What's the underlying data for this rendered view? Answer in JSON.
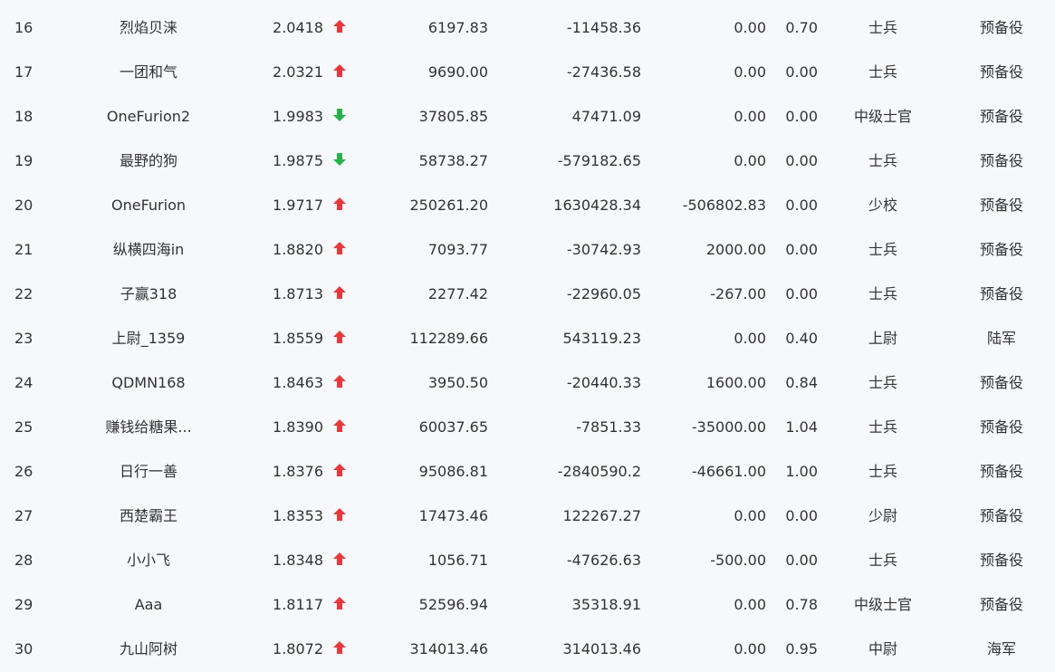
{
  "colors": {
    "up": "#e8383d",
    "down": "#27b14a",
    "text": "#333333",
    "background": "#f6f8fb"
  },
  "rows": [
    {
      "rank": "16",
      "name": "烈焰贝涞",
      "ratio": "2.0418",
      "trend": "up",
      "v1": "6197.83",
      "v2": "-11458.36",
      "v3": "0.00",
      "v4": "0.70",
      "rank_title": "士兵",
      "branch": "预备役"
    },
    {
      "rank": "17",
      "name": "一团和气",
      "ratio": "2.0321",
      "trend": "up",
      "v1": "9690.00",
      "v2": "-27436.58",
      "v3": "0.00",
      "v4": "0.00",
      "rank_title": "士兵",
      "branch": "预备役"
    },
    {
      "rank": "18",
      "name": "OneFurion2",
      "ratio": "1.9983",
      "trend": "down",
      "v1": "37805.85",
      "v2": "47471.09",
      "v3": "0.00",
      "v4": "0.00",
      "rank_title": "中级士官",
      "branch": "预备役"
    },
    {
      "rank": "19",
      "name": "最野的狗",
      "ratio": "1.9875",
      "trend": "down",
      "v1": "58738.27",
      "v2": "-579182.65",
      "v3": "0.00",
      "v4": "0.00",
      "rank_title": "士兵",
      "branch": "预备役"
    },
    {
      "rank": "20",
      "name": "OneFurion",
      "ratio": "1.9717",
      "trend": "up",
      "v1": "250261.20",
      "v2": "1630428.34",
      "v3": "-506802.83",
      "v4": "0.00",
      "rank_title": "少校",
      "branch": "预备役"
    },
    {
      "rank": "21",
      "name": "纵横四海in",
      "ratio": "1.8820",
      "trend": "up",
      "v1": "7093.77",
      "v2": "-30742.93",
      "v3": "2000.00",
      "v4": "0.00",
      "rank_title": "士兵",
      "branch": "预备役"
    },
    {
      "rank": "22",
      "name": "子赢318",
      "ratio": "1.8713",
      "trend": "up",
      "v1": "2277.42",
      "v2": "-22960.05",
      "v3": "-267.00",
      "v4": "0.00",
      "rank_title": "士兵",
      "branch": "预备役"
    },
    {
      "rank": "23",
      "name": "上尉_1359",
      "ratio": "1.8559",
      "trend": "up",
      "v1": "112289.66",
      "v2": "543119.23",
      "v3": "0.00",
      "v4": "0.40",
      "rank_title": "上尉",
      "branch": "陆军"
    },
    {
      "rank": "24",
      "name": "QDMN168",
      "ratio": "1.8463",
      "trend": "up",
      "v1": "3950.50",
      "v2": "-20440.33",
      "v3": "1600.00",
      "v4": "0.84",
      "rank_title": "士兵",
      "branch": "预备役"
    },
    {
      "rank": "25",
      "name": "赚钱给糖果...",
      "ratio": "1.8390",
      "trend": "up",
      "v1": "60037.65",
      "v2": "-7851.33",
      "v3": "-35000.00",
      "v4": "1.04",
      "rank_title": "士兵",
      "branch": "预备役"
    },
    {
      "rank": "26",
      "name": "日行一善",
      "ratio": "1.8376",
      "trend": "up",
      "v1": "95086.81",
      "v2": "-2840590.2",
      "v3": "-46661.00",
      "v4": "1.00",
      "rank_title": "士兵",
      "branch": "预备役"
    },
    {
      "rank": "27",
      "name": "西楚霸王",
      "ratio": "1.8353",
      "trend": "up",
      "v1": "17473.46",
      "v2": "122267.27",
      "v3": "0.00",
      "v4": "0.00",
      "rank_title": "少尉",
      "branch": "预备役"
    },
    {
      "rank": "28",
      "name": "小小飞",
      "ratio": "1.8348",
      "trend": "up",
      "v1": "1056.71",
      "v2": "-47626.63",
      "v3": "-500.00",
      "v4": "0.00",
      "rank_title": "士兵",
      "branch": "预备役"
    },
    {
      "rank": "29",
      "name": "Aaa",
      "ratio": "1.8117",
      "trend": "up",
      "v1": "52596.94",
      "v2": "35318.91",
      "v3": "0.00",
      "v4": "0.78",
      "rank_title": "中级士官",
      "branch": "预备役"
    },
    {
      "rank": "30",
      "name": "九山阿树",
      "ratio": "1.8072",
      "trend": "up",
      "v1": "314013.46",
      "v2": "314013.46",
      "v3": "0.00",
      "v4": "0.95",
      "rank_title": "中尉",
      "branch": "海军"
    }
  ]
}
